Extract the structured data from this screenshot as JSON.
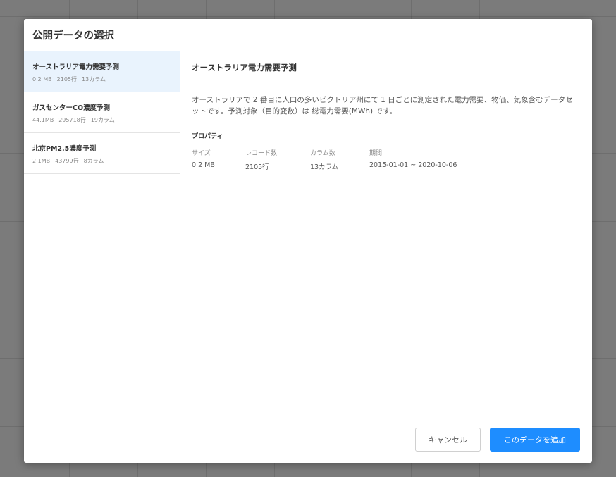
{
  "dialog": {
    "title": "公開データの選択"
  },
  "datasets": [
    {
      "title": "オーストラリア電力需要予測",
      "size": "0.2 MB",
      "rows": "2105行",
      "columns": "13カラム"
    },
    {
      "title": "ガスセンターCO濃度予測",
      "size": "44.1MB",
      "rows": "295718行",
      "columns": "19カラム"
    },
    {
      "title": "北京PM2.5濃度予測",
      "size": "2.1MB",
      "rows": "43799行",
      "columns": "8カラム"
    }
  ],
  "selected_index": 0,
  "detail": {
    "title": "オーストラリア電力需要予測",
    "description": "オーストラリアで 2 番目に人口の多いビクトリア州にて 1 日ごとに測定された電力需要、物価、気象含むデータセットです。予測対象（目的変数）は 総電力需要(MWh) です。",
    "properties_heading": "プロパティ",
    "properties": [
      {
        "label": "サイズ",
        "value": "0.2 MB"
      },
      {
        "label": "レコード数",
        "value": "2105行"
      },
      {
        "label": "カラム数",
        "value": "13カラム"
      },
      {
        "label": "期間",
        "value": "2015-01-01 ~ 2020-10-06"
      }
    ]
  },
  "buttons": {
    "cancel": "キャンセル",
    "add": "このデータを追加"
  },
  "colors": {
    "primary": "#1e8dff",
    "selected_bg": "#e9f3fd",
    "overlay": "#7b7b7b"
  }
}
